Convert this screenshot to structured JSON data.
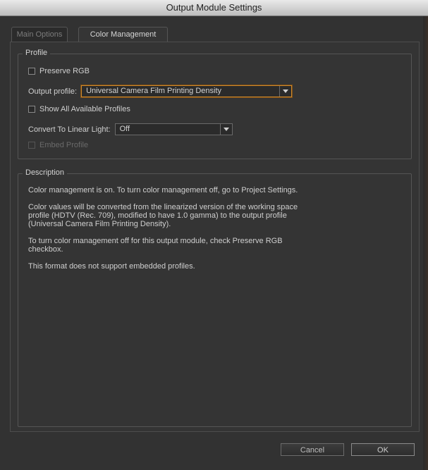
{
  "window": {
    "title": "Output Module Settings"
  },
  "tabs": [
    {
      "label": "Main Options",
      "active": false
    },
    {
      "label": "Color Management",
      "active": true
    }
  ],
  "profile": {
    "legend": "Profile",
    "preserve_rgb": {
      "label": "Preserve RGB",
      "checked": false
    },
    "output_profile": {
      "label": "Output profile:",
      "value": "Universal Camera Film Printing Density"
    },
    "show_all": {
      "label": "Show All Available Profiles",
      "checked": false
    },
    "convert_linear": {
      "label": "Convert To Linear Light:",
      "value": "Off"
    },
    "embed_profile": {
      "label": "Embed Profile",
      "checked": false,
      "enabled": false
    }
  },
  "description": {
    "legend": "Description",
    "paragraphs": [
      "Color management is on. To turn color management off, go to Project Settings.",
      "Color values will be converted from the linearized version of the working space",
      "profile (HDTV (Rec. 709), modified to have 1.0 gamma) to the output profile",
      "(Universal Camera Film Printing Density).",
      "To turn color management off for this output module, check Preserve RGB",
      "checkbox.",
      "This format does not support embedded profiles."
    ]
  },
  "buttons": {
    "cancel": "Cancel",
    "ok": "OK"
  },
  "colors": {
    "accent_focus": "#d08a2c",
    "background": "#323232"
  }
}
